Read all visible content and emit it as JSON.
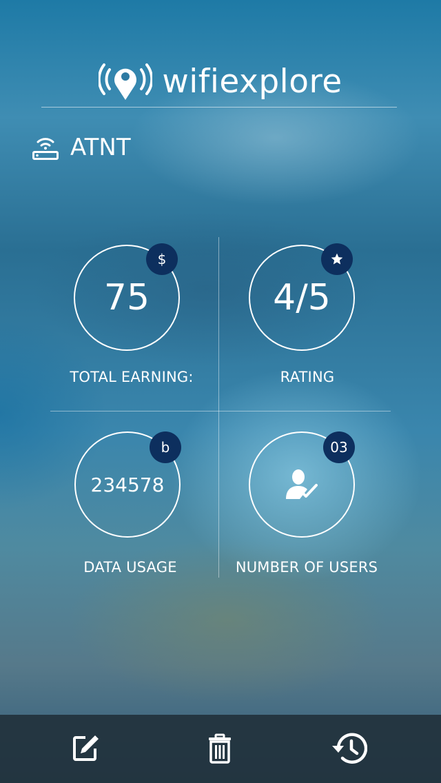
{
  "app": {
    "brand": "wifiexplore",
    "logo_icon": "wifi-location-pin-icon"
  },
  "network": {
    "icon": "router-icon",
    "name": "ATNT"
  },
  "stats": {
    "earning": {
      "value": "75",
      "badge": "$",
      "label": "TOTAL EARNING:"
    },
    "rating": {
      "value": "4/5",
      "badge_icon": "star-icon",
      "label": "RATING"
    },
    "data_usage": {
      "value": "234578",
      "badge": "b",
      "label": "DATA USAGE"
    },
    "users": {
      "value_icon": "user-check-icon",
      "badge": "03",
      "label": "NUMBER OF USERS"
    }
  },
  "toolbar": {
    "edit_icon": "edit-icon",
    "delete_icon": "trash-icon",
    "history_icon": "history-icon"
  },
  "colors": {
    "badge": "#0d2f5e",
    "bottom_bar": "#22323c"
  }
}
